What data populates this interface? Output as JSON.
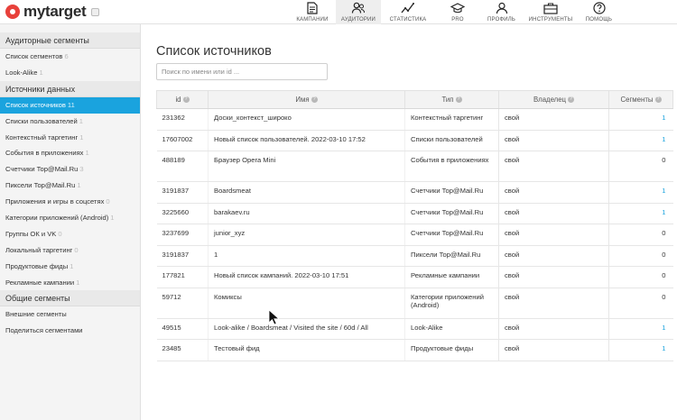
{
  "app": {
    "logo_text": "mytarget",
    "brand_color": "#e8413b",
    "accent_color": "#1aa3de"
  },
  "nav": [
    {
      "label": "КАМПАНИИ",
      "icon": "document-icon"
    },
    {
      "label": "АУДИТОРИИ",
      "icon": "audience-icon",
      "active": true
    },
    {
      "label": "СТАТИСТИКА",
      "icon": "chart-icon"
    },
    {
      "label": "PRO",
      "icon": "graduation-cap-icon"
    },
    {
      "label": "ПРОФИЛЬ",
      "icon": "user-icon"
    },
    {
      "label": "ИНСТРУМЕНТЫ",
      "icon": "toolbox-icon"
    },
    {
      "label": "ПОМОЩЬ",
      "icon": "help-icon"
    }
  ],
  "sidebar": {
    "sections": [
      {
        "header": "Аудиторные сегменты",
        "items": [
          {
            "label": "Список сегментов",
            "count": "6"
          },
          {
            "label": "Look-Alike",
            "count": "1"
          }
        ]
      },
      {
        "header": "Источники данных",
        "items": [
          {
            "label": "Список источников",
            "count": "11",
            "active": true
          },
          {
            "label": "Списки пользователей",
            "count": "1"
          },
          {
            "label": "Контекстный таргетинг",
            "count": "1"
          },
          {
            "label": "События в приложениях",
            "count": "1"
          },
          {
            "label": "Счетчики Top@Mail.Ru",
            "count": "3"
          },
          {
            "label": "Пиксели Top@Mail.Ru",
            "count": "1"
          },
          {
            "label": "Приложения и игры в соцсетях",
            "count": "0"
          },
          {
            "label": "Категории приложений (Android)",
            "count": "1"
          },
          {
            "label": "Группы ОК и VK",
            "count": "0"
          },
          {
            "label": "Локальный таргетинг",
            "count": "0"
          },
          {
            "label": "Продуктовые фиды",
            "count": "1"
          },
          {
            "label": "Рекламные кампании",
            "count": "1"
          }
        ]
      },
      {
        "header": "Общие сегменты",
        "items": [
          {
            "label": "Внешние сегменты",
            "count": ""
          },
          {
            "label": "Поделиться сегментами",
            "count": ""
          }
        ]
      }
    ]
  },
  "main": {
    "title": "Список источников",
    "search_placeholder": "Поиск по имени или id ...",
    "columns": [
      "id",
      "Имя",
      "Тип",
      "Владелец",
      "Сегменты"
    ],
    "rows": [
      {
        "id": "231362",
        "name": "Доски_контекст_широко",
        "type": "Контекстный таргетинг",
        "owner": "свой",
        "segments": "1"
      },
      {
        "id": "17607002",
        "name": "Новый список пользователей. 2022-03-10 17:52",
        "type": "Списки пользователей",
        "owner": "свой",
        "segments": "1"
      },
      {
        "id": "488189",
        "name": "Браузер Opera Mini",
        "type": "События в приложениях",
        "owner": "свой",
        "segments": "0",
        "tall": true
      },
      {
        "id": "3191837",
        "name": "Boardsmeat",
        "type": "Счетчики Top@Mail.Ru",
        "owner": "свой",
        "segments": "1"
      },
      {
        "id": "3225660",
        "name": "barakaev.ru",
        "type": "Счетчики Top@Mail.Ru",
        "owner": "свой",
        "segments": "1"
      },
      {
        "id": "3237699",
        "name": "junior_xyz",
        "type": "Счетчики Top@Mail.Ru",
        "owner": "свой",
        "segments": "0"
      },
      {
        "id": "3191837",
        "name": "1",
        "type": "Пиксели Top@Mail.Ru",
        "owner": "свой",
        "segments": "0"
      },
      {
        "id": "177821",
        "name": "Новый список кампаний. 2022-03-10 17:51",
        "type": "Рекламные кампании",
        "owner": "свой",
        "segments": "0"
      },
      {
        "id": "59712",
        "name": "Комиксы",
        "type": "Категории приложений (Android)",
        "owner": "свой",
        "segments": "0",
        "tall": true
      },
      {
        "id": "49515",
        "name": "Look-alike / Boardsmeat / Visited the site / 60d / All",
        "type": "Look-Alike",
        "owner": "свой",
        "segments": "1"
      },
      {
        "id": "23485",
        "name": "Тестовый фид",
        "type": "Продуктовые фиды",
        "owner": "свой",
        "segments": "1"
      }
    ]
  }
}
